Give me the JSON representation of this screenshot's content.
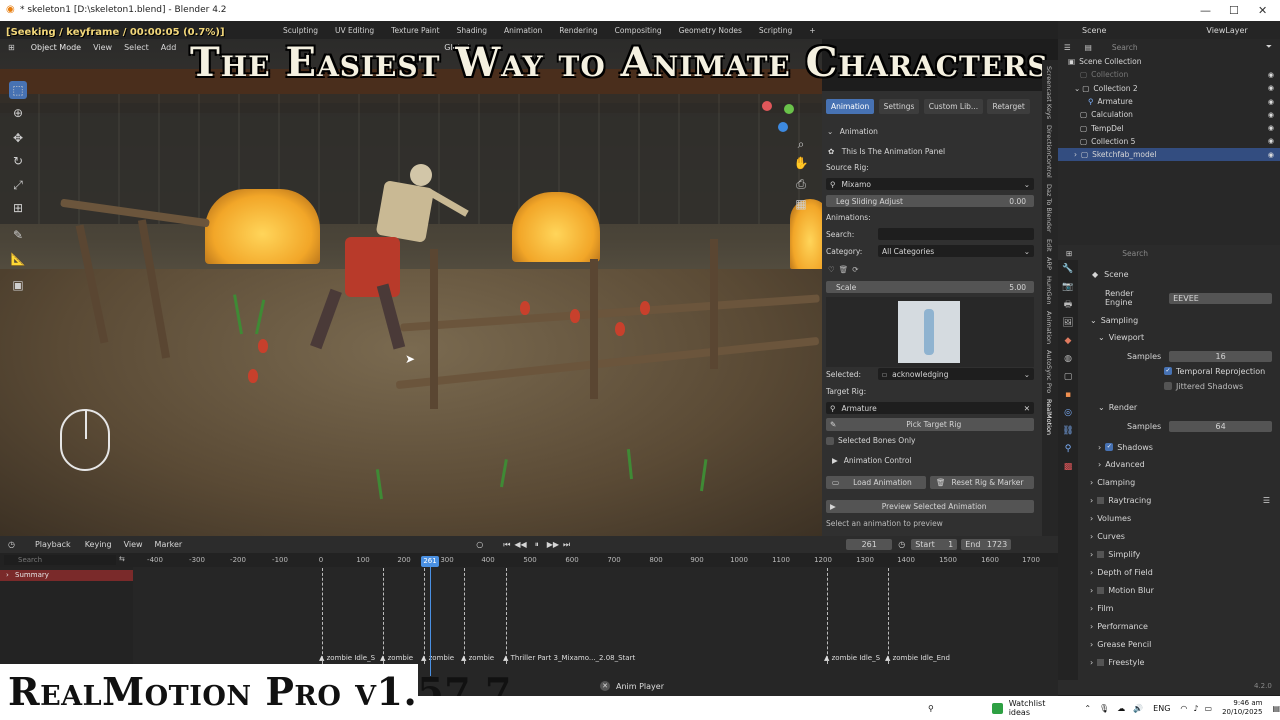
{
  "window": {
    "title": "* skeleton1 [D:\\skeleton1.blend] - Blender 4.2",
    "min": "—",
    "max": "☐",
    "close": "✕"
  },
  "overlay": {
    "seeking": "[Seeking / keyframe / 00:00:05 (0.7%)]",
    "headline": "The Easiest Way to Animate Characters in Blender",
    "watermark": "RealMotion Pro v1.57.7"
  },
  "menu": {
    "workspaces": [
      "Sculpting",
      "UV Editing",
      "Texture Paint",
      "Shading",
      "Animation",
      "Rendering",
      "Compositing",
      "Geometry Nodes",
      "Scripting"
    ],
    "add_tab": "+",
    "scene": "Scene",
    "view_layer": "ViewLayer"
  },
  "viewport_header": {
    "mode": "Object Mode",
    "items": [
      "View",
      "Select",
      "Add"
    ],
    "orientation": "Global"
  },
  "npanel": {
    "tabs": [
      "Animation",
      "Settings",
      "Custom Lib...",
      "Retarget"
    ],
    "active_tab": "Animation",
    "section": "Animation",
    "note": "This Is The Animation Panel",
    "source_rig_label": "Source Rig:",
    "source_rig": "Mixamo",
    "leg_sliding_label": "Leg Sliding Adjust",
    "leg_sliding_value": "0.00",
    "animations_label": "Animations:",
    "search_label": "Search:",
    "category_label": "Category:",
    "category": "All Categories",
    "scale_label": "Scale",
    "scale_value": "5.00",
    "selected_label": "Selected:",
    "selected_value": "acknowledging",
    "target_rig_label": "Target Rig:",
    "target_rig": "Armature",
    "pick_target": "Pick Target Rig",
    "selected_bones": "Selected Bones Only",
    "animation_control": "Animation Control",
    "load_animation": "Load Animation",
    "reset_rig": "Reset Rig & Marker",
    "preview": "Preview Selected Animation",
    "hint": "Select an animation to preview"
  },
  "vtabs": [
    "RealMotion",
    "AutoSync Pro",
    "Animation",
    "HumGen",
    "ARP",
    "Edit",
    "Daz To Blender",
    "DirectionControl",
    "Screencast Keys"
  ],
  "outliner": {
    "search_placeholder": "Search",
    "rows": [
      {
        "label": "Scene Collection",
        "indent": 0
      },
      {
        "label": "Collection",
        "indent": 1
      },
      {
        "label": "Collection 2",
        "indent": 1
      },
      {
        "label": "Armature",
        "indent": 2
      },
      {
        "label": "Calculation",
        "indent": 1
      },
      {
        "label": "TempDel",
        "indent": 1
      },
      {
        "label": "Collection 5",
        "indent": 1
      },
      {
        "label": "Sketchfab_model",
        "indent": 1
      }
    ]
  },
  "properties": {
    "search_placeholder": "Search",
    "scene": "Scene",
    "render_engine_label": "Render Engine",
    "render_engine": "EEVEE",
    "sampling": "Sampling",
    "viewport": "Viewport",
    "samples_label": "Samples",
    "viewport_samples": "16",
    "temporal_reprojection": "Temporal Reprojection",
    "jittered_shadows": "Jittered Shadows",
    "render": "Render",
    "render_samples": "64",
    "shadows": "Shadows",
    "advanced": "Advanced",
    "sections": [
      "Clamping",
      "Raytracing",
      "Volumes",
      "Curves",
      "Simplify",
      "Depth of Field",
      "Motion Blur",
      "Film",
      "Performance",
      "Grease Pencil",
      "Freestyle"
    ],
    "version": "4.2.0"
  },
  "timeline": {
    "menus": [
      "Playback",
      "Keying",
      "View",
      "Marker"
    ],
    "search_placeholder": "Search",
    "current_frame": "261",
    "start_label": "Start",
    "start": "1",
    "end_label": "End",
    "end": "1723",
    "summary": "Summary",
    "ticks": [
      "-400",
      "-300",
      "-200",
      "-100",
      "0",
      "100",
      "200",
      "300",
      "400",
      "500",
      "600",
      "700",
      "800",
      "900",
      "1000",
      "1100",
      "1200",
      "1300",
      "1400",
      "1500",
      "1600",
      "1700"
    ],
    "markers": [
      "zombie Idle_S",
      "zombie",
      "zombie",
      "zombie",
      "Thriller Part 3_Mixamo..._2.08_Start",
      "zombie Idle_S",
      "zombie Idle_End"
    ],
    "status": "Anim Player"
  },
  "taskbar": {
    "watchlist": "Watchlist ideas",
    "lang": "ENG",
    "time": "9:46 am",
    "date": "20/10/2025"
  }
}
